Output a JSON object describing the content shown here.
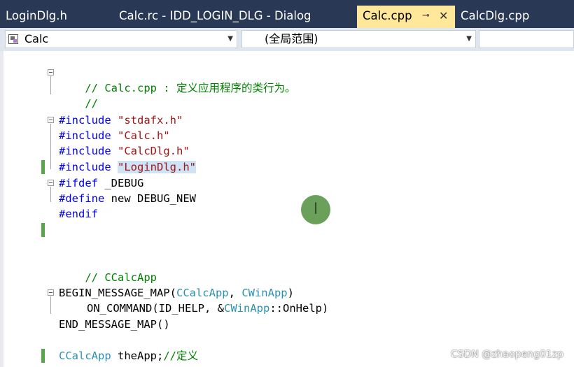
{
  "tabs": [
    {
      "label": "LoginDlg.h",
      "active": false
    },
    {
      "label": "Calc.rc - IDD_LOGIN_DLG - Dialog",
      "active": false
    },
    {
      "label": "Calc.cpp",
      "active": true,
      "pin_icon": "pin-icon",
      "close_icon": "close-icon"
    },
    {
      "label": "CalcDlg.cpp",
      "active": false
    }
  ],
  "navbar": {
    "project_combo": "Calc",
    "scope_combo": "(全局范围)",
    "member_combo": ""
  },
  "code": {
    "line1_comment": "// Calc.cpp : 定义应用程序的类行为。",
    "line2_comment": "//",
    "inc1_kw": "#include",
    "inc1_file": "\"stdafx.h\"",
    "inc2_kw": "#include",
    "inc2_file": "\"Calc.h\"",
    "inc3_kw": "#include",
    "inc3_file": "\"CalcDlg.h\"",
    "inc4_kw": "#include",
    "inc4_file": "\"LoginDlg.h\"",
    "ifdef_kw": "#ifdef",
    "ifdef_sym": "_DEBUG",
    "define_kw": "#define",
    "define_a": "new",
    "define_b": "DEBUG_NEW",
    "endif_kw": "#endif",
    "section_comment": "// CCalcApp",
    "begin_map": "BEGIN_MESSAGE_MAP",
    "begin_arg1": "CCalcApp",
    "begin_arg2": "CWinApp",
    "on_command": "ON_COMMAND",
    "on_cmd_id": "ID_HELP",
    "on_cmd_class": "CWinApp",
    "on_cmd_method": "OnHelp",
    "end_map": "END_MESSAGE_MAP",
    "app_type": "CCalcApp",
    "app_var": "theApp",
    "app_comment": "//定义"
  },
  "cursor_glyph": "I",
  "watermark": "CSDN @zhaopeng01zp",
  "colors": {
    "tab_bg": "#293955",
    "active_tab": "#ffe89a",
    "comment": "#008000",
    "keyword": "#0000ff",
    "string": "#a31515",
    "type": "#2b91af",
    "change_marker": "#57a64a"
  }
}
